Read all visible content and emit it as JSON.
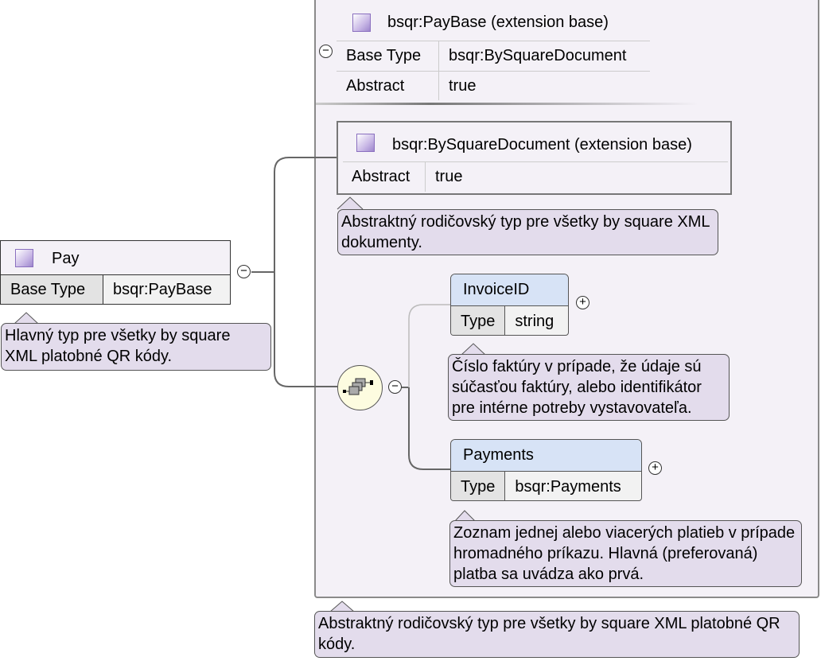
{
  "paybase": {
    "title": "bsqr:PayBase (extension base)",
    "rows": [
      {
        "key": "Base Type",
        "value": "bsqr:BySquareDocument"
      },
      {
        "key": "Abstract",
        "value": "true"
      }
    ]
  },
  "bysquare": {
    "title": "bsqr:BySquareDocument (extension base)",
    "rows": [
      {
        "key": "Abstract",
        "value": "true"
      }
    ],
    "doc": "Abstraktný rodičovský typ pre všetky by square XML dokumenty."
  },
  "pay": {
    "title": "Pay",
    "rows": [
      {
        "key": "Base Type",
        "value": "bsqr:PayBase"
      }
    ],
    "doc": "Hlavný typ pre všetky by square XML platobné QR kódy."
  },
  "elements": [
    {
      "name": "InvoiceID",
      "type_label": "Type",
      "type": "string",
      "doc": "Číslo faktúry v prípade, že údaje sú súčasťou faktúry, alebo identifikátor pre intérne potreby vystavovateľa."
    },
    {
      "name": "Payments",
      "type_label": "Type",
      "type": "bsqr:Payments",
      "doc": "Zoznam jednej alebo viacerých platieb v prípade hromadného príkazu. Hlavná (preferovaná) platba sa uvádza ako prvá."
    }
  ],
  "paybase_doc": "Abstraktný rodičovský typ pre všetky by square XML platobné QR kódy.",
  "symbols": {
    "collapse": "−",
    "expand": "+"
  },
  "colors": {
    "complex_type": "#f4f1f7",
    "element_header": "#d7e3f6",
    "annotation": "#e3dcec",
    "sequence": "#fdfce0"
  }
}
